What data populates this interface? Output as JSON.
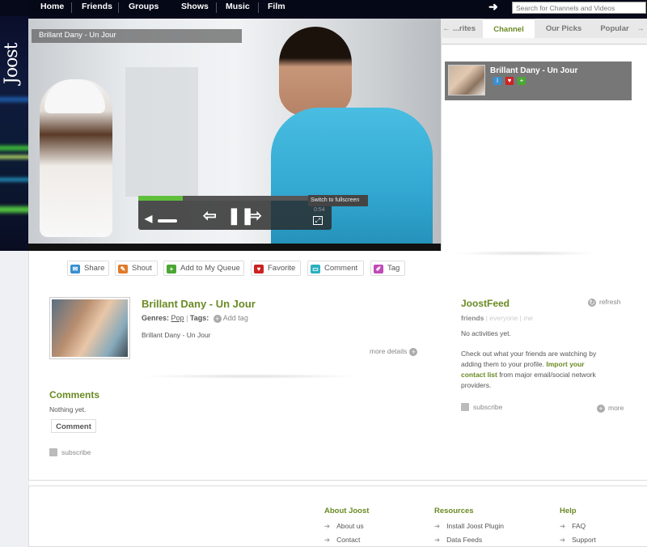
{
  "nav": {
    "items": [
      "Home",
      "Friends",
      "Groups",
      "Shows",
      "Music",
      "Film"
    ],
    "search_placeholder": "Search for Channels and Videos"
  },
  "logo": "Joost",
  "player": {
    "title": "Brillant Dany - Un Jour",
    "progress_fraction": 0.23,
    "fullscreen_tooltip": "Switch to fullscreen",
    "time": "0:54"
  },
  "tabs": {
    "items": [
      "...rites",
      "Channel",
      "Our Picks",
      "Popular"
    ],
    "active": "Channel"
  },
  "channel_item": {
    "title": "Brillant Dany - Un Jour"
  },
  "actions": [
    "Share",
    "Shout",
    "Add to My Queue",
    "Favorite",
    "Comment",
    "Tag"
  ],
  "item": {
    "title": "Brillant Dany - Un Jour",
    "genres_label": "Genres:",
    "genre": "Pop",
    "tags_label": "Tags:",
    "add_tag": "Add tag",
    "description": "Brillant Dany - Un Jour",
    "more_details": "more details"
  },
  "comments": {
    "heading": "Comments",
    "empty": "Nothing yet.",
    "button": "Comment",
    "subscribe": "subscribe"
  },
  "feed": {
    "heading": "JoostFeed",
    "refresh": "refresh",
    "tab_friends": "friends",
    "tab_sep1": " | ",
    "tab_everyone": "everyone",
    "tab_sep2": " | ",
    "tab_me": "me",
    "no_activities": "No activities yet.",
    "msg1": "Check out what your friends are watching by adding them to your profile.",
    "import_link": "Import your contact list",
    "msg2": "from major email/social network providers.",
    "subscribe": "subscribe",
    "more": "more"
  },
  "footer": {
    "about": {
      "heading": "About Joost",
      "links": [
        "About us",
        "Contact"
      ]
    },
    "resources": {
      "heading": "Resources",
      "links": [
        "Install Joost Plugin",
        "Data Feeds"
      ]
    },
    "help": {
      "heading": "Help",
      "links": [
        "FAQ",
        "Support"
      ]
    }
  },
  "colors": {
    "accent": "#6a8a23",
    "nav_bg": "#050817",
    "progress": "#5fbf3a"
  }
}
